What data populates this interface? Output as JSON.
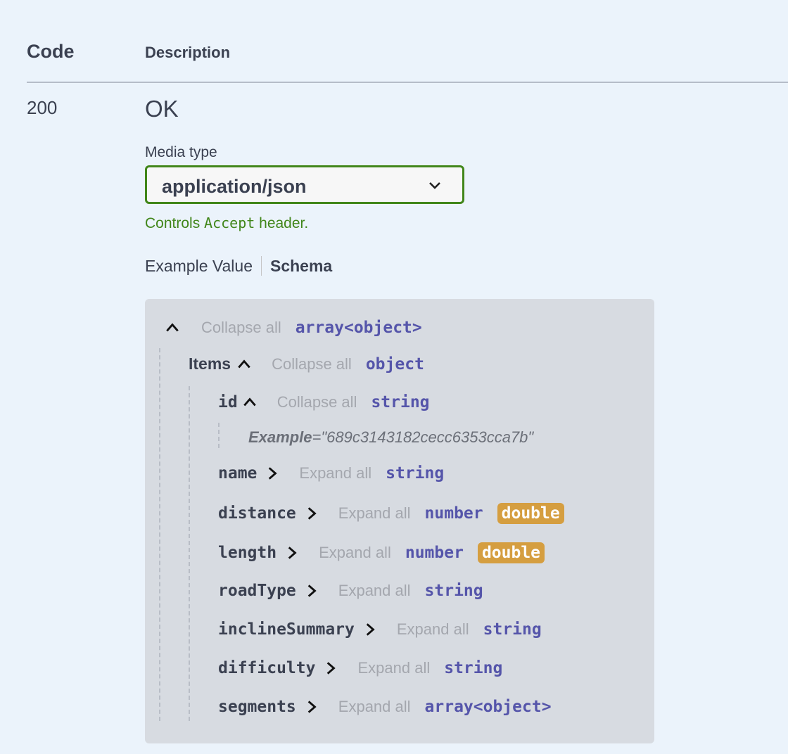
{
  "header": {
    "code": "Code",
    "description": "Description"
  },
  "response": {
    "code": "200",
    "description": "OK",
    "media_type_label": "Media type",
    "media_type_value": "application/json",
    "controls_prefix": "Controls",
    "controls_mono": "Accept",
    "controls_suffix": "header."
  },
  "tabs": {
    "example": "Example Value",
    "schema": "Schema"
  },
  "schema": {
    "root": {
      "action": "Collapse all",
      "type": "array<object>"
    },
    "items": {
      "label": "Items",
      "action": "Collapse all",
      "type": "object"
    },
    "id": {
      "key": "id",
      "action": "Collapse all",
      "type": "string",
      "example_label": "Example",
      "example_value": "=\"689c3143182cecc6353cca7b\""
    },
    "fields": [
      {
        "key": "name",
        "action": "Expand all",
        "type": "string",
        "format": ""
      },
      {
        "key": "distance",
        "action": "Expand all",
        "type": "number",
        "format": "double"
      },
      {
        "key": "length",
        "action": "Expand all",
        "type": "number",
        "format": "double"
      },
      {
        "key": "roadType",
        "action": "Expand all",
        "type": "string",
        "format": ""
      },
      {
        "key": "inclineSummary",
        "action": "Expand all",
        "type": "string",
        "format": ""
      },
      {
        "key": "difficulty",
        "action": "Expand all",
        "type": "string",
        "format": ""
      },
      {
        "key": "segments",
        "action": "Expand all",
        "type": "array<object>",
        "format": ""
      }
    ]
  },
  "colors": {
    "accent_green": "#41861a",
    "type_purple": "#55a",
    "badge": "#d59e40",
    "panel_bg": "#d7dbe1"
  }
}
